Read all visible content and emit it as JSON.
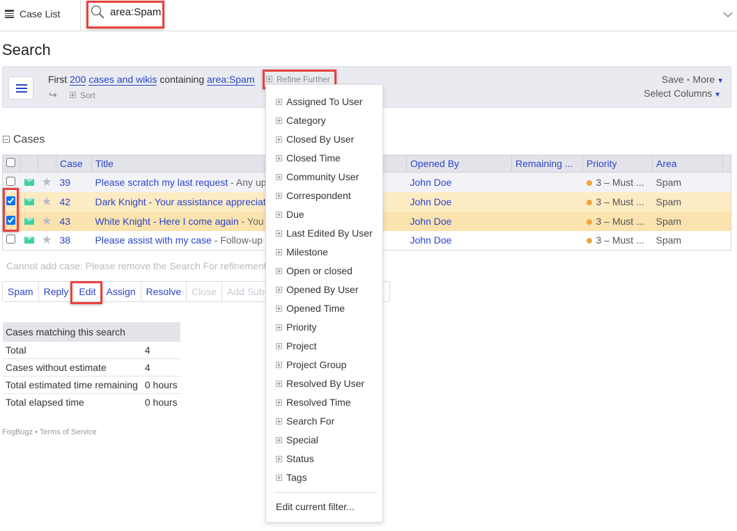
{
  "topbar": {
    "case_list": "Case List",
    "search_value": "area:Spam"
  },
  "page_title": "Search",
  "filter": {
    "first": "First",
    "count": "200",
    "kind": "cases and wikis",
    "containing": "containing",
    "query": "area:Spam",
    "refine": "Refine Further",
    "sort": "Sort",
    "save": "Save",
    "more": "More",
    "select_columns": "Select Columns"
  },
  "cases_heading": "Cases",
  "columns": [
    "Case",
    "Title",
    "Opened By",
    "Remaining ...",
    "Priority",
    "Area"
  ],
  "rows": [
    {
      "case": "39",
      "title": "Please scratch my last request",
      "excerpt": " - Any up",
      "opened_by": "John Doe",
      "priority": "3 – Must ...",
      "area": "Spam",
      "checked": false
    },
    {
      "case": "42",
      "title": "Dark Knight - Your assistance appreciat",
      "excerpt": "",
      "opened_by": "John Doe",
      "priority": "3 – Must ...",
      "area": "Spam",
      "checked": true
    },
    {
      "case": "43",
      "title": "White Knight - Here I come again",
      "excerpt": " - You",
      "opened_by": "John Doe",
      "priority": "3 – Must ...",
      "area": "Spam",
      "checked": true
    },
    {
      "case": "38",
      "title": "Please assist with my case",
      "excerpt": " - Follow-up",
      "opened_by": "John Doe",
      "priority": "3 – Must ...",
      "area": "Spam",
      "checked": false
    }
  ],
  "message": "Cannot add case: Please remove the Search For refinement",
  "actions": [
    "Spam",
    "Reply",
    "Edit",
    "Assign",
    "Resolve",
    "Close",
    "Add Subcase"
  ],
  "stats": {
    "title": "Cases matching this search",
    "rows": [
      [
        "Total",
        "4"
      ],
      [
        "Cases without estimate",
        "4"
      ],
      [
        "Total estimated time remaining",
        "0 hours"
      ],
      [
        "Total elapsed time",
        "0 hours"
      ]
    ]
  },
  "footer": {
    "brand": "FogBugz",
    "terms": "Terms of Service"
  },
  "dropdown": {
    "items": [
      "Assigned To User",
      "Category",
      "Closed By User",
      "Closed Time",
      "Community User",
      "Correspondent",
      "Due",
      "Last Edited By User",
      "Milestone",
      "Open or closed",
      "Opened By User",
      "Opened Time",
      "Priority",
      "Project",
      "Project Group",
      "Resolved By User",
      "Resolved Time",
      "Search For",
      "Special",
      "Status",
      "Tags"
    ],
    "edit_filter": "Edit current filter..."
  },
  "colors": {
    "link": "#2a44c8",
    "highlight": "#e8413f",
    "row_selected": "#fdebc4",
    "priority_dot": "#f0a53c"
  }
}
